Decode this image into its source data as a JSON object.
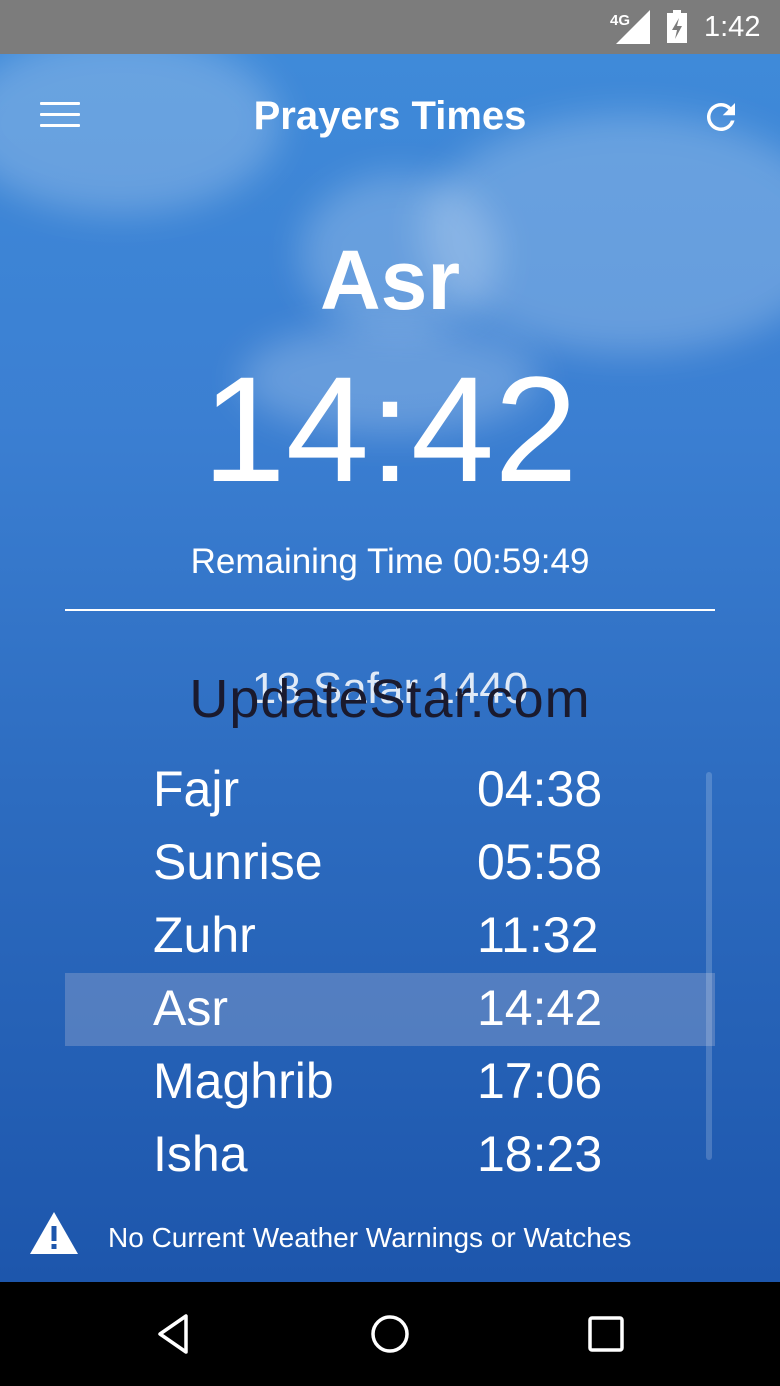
{
  "status_bar": {
    "network": "4G",
    "time": "1:42"
  },
  "header": {
    "title": "Prayers Times"
  },
  "current": {
    "prayer": "Asr",
    "time": "14:42",
    "remaining": "Remaining Time 00:59:49"
  },
  "hijri_date": "18 Safar 1440",
  "watermark": "UpdateStar.com",
  "prayers": [
    {
      "name": "Fajr",
      "time": "04:38"
    },
    {
      "name": "Sunrise",
      "time": "05:58"
    },
    {
      "name": "Zuhr",
      "time": "11:32"
    },
    {
      "name": "Asr",
      "time": "14:42"
    },
    {
      "name": "Maghrib",
      "time": "17:06"
    },
    {
      "name": "Isha",
      "time": "18:23"
    }
  ],
  "active_prayer_index": 3,
  "weather": {
    "message": "No Current Weather Warnings or Watches"
  },
  "icons": {
    "menu": "menu-icon",
    "refresh": "refresh-icon",
    "warning": "warning-icon",
    "back": "back-icon",
    "home": "home-icon",
    "recents": "recents-icon"
  },
  "colors": {
    "sky_top": "#3f8ad9",
    "sky_bottom": "#1d56ac",
    "status_bar": "#7c7c7c"
  }
}
